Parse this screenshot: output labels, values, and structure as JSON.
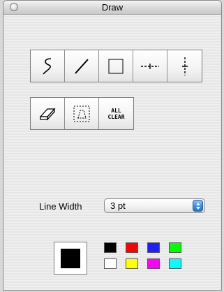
{
  "window": {
    "title": "Draw"
  },
  "tools_row1": [
    {
      "name": "freehand-tool",
      "icon": "freehand-curve-icon"
    },
    {
      "name": "line-tool",
      "icon": "diagonal-line-icon"
    },
    {
      "name": "rectangle-tool",
      "icon": "rectangle-icon"
    },
    {
      "name": "horizontal-line-tool",
      "icon": "horizontal-dashed-line-icon"
    },
    {
      "name": "vertical-line-tool",
      "icon": "vertical-dashed-line-icon"
    }
  ],
  "tools_row2": [
    {
      "name": "eraser-tool",
      "icon": "eraser-icon"
    },
    {
      "name": "selection-eraser-tool",
      "icon": "dotted-select-eraser-icon"
    },
    {
      "name": "all-clear-button",
      "line1": "ALL",
      "line2": "CLEAR"
    }
  ],
  "line_width": {
    "label": "Line Width",
    "value": "3 pt"
  },
  "current_color": "#000000",
  "palette": [
    "#000000",
    "#ff0000",
    "#2020ff",
    "#00ff00",
    "#ffffff",
    "#ffff00",
    "#ff00ff",
    "#00ffff"
  ]
}
